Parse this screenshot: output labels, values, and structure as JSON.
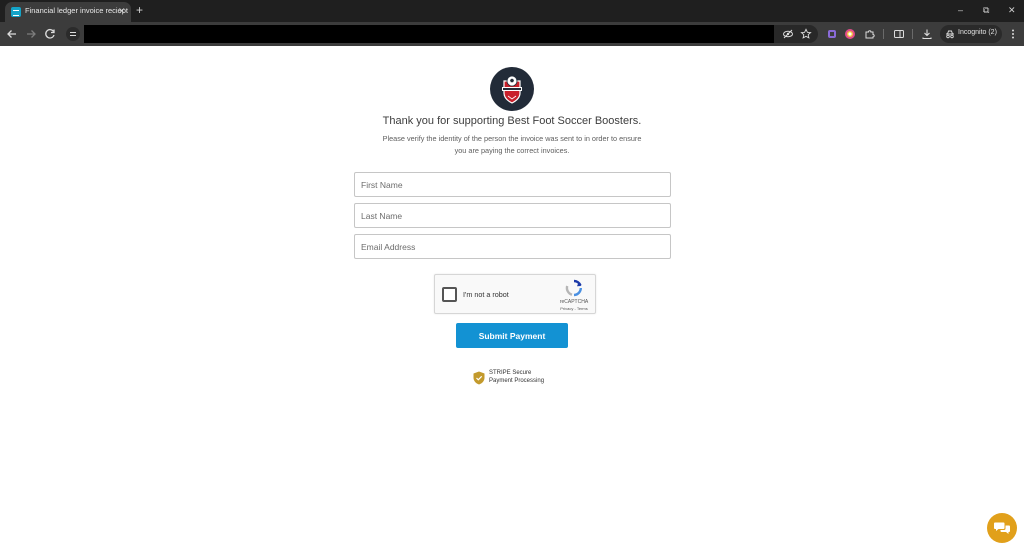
{
  "browser": {
    "tab_title": "Financial ledger invoice reciept",
    "tab_close": "✕",
    "new_tab": "+",
    "window_controls": {
      "minimize": "–",
      "restore": "⧉",
      "close": "✕"
    },
    "incognito_label": "Incognito (2)",
    "colors": {
      "titlebar": "#1f1f1f",
      "toolbar": "#3c3c3c",
      "tab": "#3c3c3c"
    }
  },
  "page": {
    "heading": "Thank you for supporting Best Foot Soccer Boosters.",
    "subtext_line1": "Please verify the identity of the person the invoice was sent to in order to ensure",
    "subtext_line2": "you are paying the correct invoices.",
    "fields": {
      "first_name": {
        "placeholder": "First Name",
        "value": ""
      },
      "last_name": {
        "placeholder": "Last Name",
        "value": ""
      },
      "email": {
        "placeholder": "Email Address",
        "value": ""
      }
    },
    "captcha": {
      "label": "I'm not a robot",
      "brand": "reCAPTCHA",
      "links": "Privacy - Terms",
      "checked": false
    },
    "submit_label": "Submit Payment",
    "secure_line1": "STRIPE Secure",
    "secure_line2": "Payment Processing",
    "colors": {
      "accent": "#1392d3",
      "shield": "#c39a2c",
      "chat": "#e1a01b",
      "logo_bg": "#222b38"
    }
  }
}
